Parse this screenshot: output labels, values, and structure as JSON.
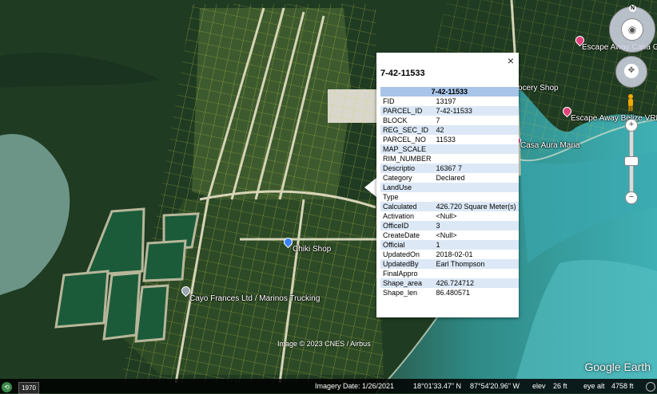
{
  "map": {
    "places": [
      {
        "name": "Escape Away Casa Gran",
        "type": "pink"
      },
      {
        "name": "ocery Shop",
        "type": "none"
      },
      {
        "name": "Escape Away Belize VRBO",
        "type": "pink"
      },
      {
        "name": "Casa Aura Maria",
        "type": "pink"
      },
      {
        "name": "Chiki Shop",
        "type": "blue"
      },
      {
        "name": "Cayo Frances Ltd / Marinos Trucking",
        "type": "gray"
      }
    ],
    "credit": "Image © 2023 CNES / Airbus",
    "brand": "Google Earth"
  },
  "popup": {
    "close_icon": "×",
    "title": "7-42-11533",
    "table_header": "7-42-11533",
    "rows": [
      {
        "key": "FID",
        "value": "13197"
      },
      {
        "key": "PARCEL_ID",
        "value": "7-42-11533"
      },
      {
        "key": "BLOCK",
        "value": "7"
      },
      {
        "key": "REG_SEC_ID",
        "value": "42"
      },
      {
        "key": "PARCEL_NO",
        "value": "11533"
      },
      {
        "key": "MAP_SCALE",
        "value": ""
      },
      {
        "key": "RIM_NUMBER",
        "value": ""
      },
      {
        "key": "Descriptio",
        "value": "16367 7"
      },
      {
        "key": "Category",
        "value": "Declared"
      },
      {
        "key": "LandUse",
        "value": ""
      },
      {
        "key": "Type",
        "value": ""
      },
      {
        "key": "Calculated",
        "value": "426.720 Square Meter(s)"
      },
      {
        "key": "Activation",
        "value": "<Null>"
      },
      {
        "key": "OfficeID",
        "value": "3"
      },
      {
        "key": "CreateDate",
        "value": "<Null>"
      },
      {
        "key": "Official",
        "value": "1"
      },
      {
        "key": "UpdatedOn",
        "value": "2018-02-01"
      },
      {
        "key": "UpdatedBy",
        "value": "Earl Thompson"
      },
      {
        "key": "FinalAppro",
        "value": ""
      },
      {
        "key": "Shape_area",
        "value": "426.724712"
      },
      {
        "key": "Shape_len",
        "value": "86.480571"
      }
    ]
  },
  "status": {
    "year_button": "1970",
    "imagery_date": "Imagery Date: 1/26/2021",
    "latitude": "18°01'33.47\" N",
    "longitude": "87°54'20.96\" W",
    "elev_label": "elev",
    "elev_value": "26 ft",
    "eye_alt_label": "eye alt",
    "eye_alt_value": "4758 ft"
  },
  "controls": {
    "north_label": "N",
    "look_icon": "◉",
    "move_icon": "✥",
    "zoom_in": "+",
    "zoom_out": "−"
  }
}
